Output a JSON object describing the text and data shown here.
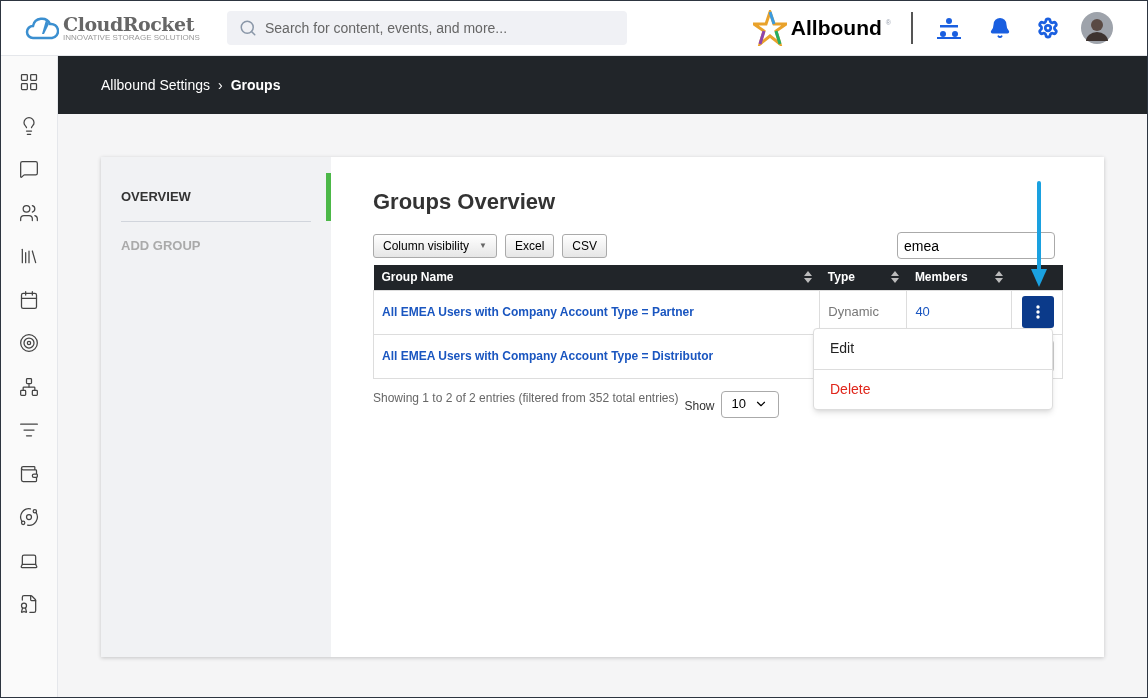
{
  "header": {
    "logo": {
      "name": "CloudRocket",
      "tagline": "INNOVATIVE STORAGE SOLUTIONS"
    },
    "search": {
      "placeholder": "Search for content, events, and more..."
    },
    "brand": "Allbound",
    "brand_mark": "®"
  },
  "sidebar": {
    "items": [
      {
        "kind": "grid",
        "selected": false
      },
      {
        "kind": "bulb",
        "selected": false
      },
      {
        "kind": "chat",
        "selected": false
      },
      {
        "kind": "people",
        "selected": false
      },
      {
        "kind": "library",
        "selected": false
      },
      {
        "kind": "calendar",
        "selected": false
      },
      {
        "kind": "target",
        "selected": false
      },
      {
        "kind": "network",
        "selected": false
      },
      {
        "kind": "filter",
        "selected": false
      },
      {
        "kind": "wallet",
        "selected": false
      },
      {
        "kind": "orbit",
        "selected": false
      },
      {
        "kind": "laptop",
        "selected": false
      },
      {
        "kind": "certificate",
        "selected": false
      }
    ]
  },
  "breadcrumb": {
    "parent": "Allbound Settings",
    "separator": "›",
    "current": "Groups"
  },
  "settings_nav": [
    {
      "label": "OVERVIEW",
      "selected": true
    },
    {
      "label": "ADD GROUP",
      "selected": false
    }
  ],
  "main": {
    "title": "Groups Overview",
    "buttons": [
      {
        "label": "Column visibility",
        "caret": "▼"
      },
      {
        "label": "Excel"
      },
      {
        "label": "CSV"
      }
    ],
    "filter": {
      "value": "emea"
    },
    "table": {
      "columns": [
        "Group Name",
        "Type",
        "Members"
      ],
      "rows": [
        {
          "name": "All EMEA Users with Company Account Type = Partner",
          "type": "Dynamic",
          "members": "40",
          "menu_open": true
        },
        {
          "name": "All EMEA Users with Company Account Type = Distributor",
          "menu_open": false
        }
      ]
    },
    "info": "Showing 1 to 2 of 2 entries (filtered from 352 total entries)",
    "show_label": "Show",
    "page_size": "10",
    "menu": [
      {
        "label": "Edit",
        "kind": "normal"
      },
      {
        "label": "Delete",
        "kind": "danger"
      }
    ]
  }
}
